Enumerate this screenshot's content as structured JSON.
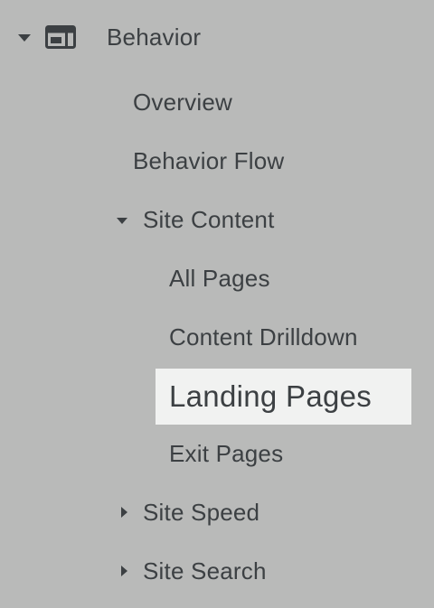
{
  "nav": {
    "section": {
      "label": "Behavior",
      "icon": "layout-icon",
      "expanded": true
    },
    "items": [
      {
        "label": "Overview"
      },
      {
        "label": "Behavior Flow"
      }
    ],
    "site_content": {
      "label": "Site Content",
      "expanded": true,
      "children": [
        {
          "label": "All Pages"
        },
        {
          "label": "Content Drilldown"
        },
        {
          "label": "Landing Pages",
          "selected": true
        },
        {
          "label": "Exit Pages"
        }
      ]
    },
    "site_speed": {
      "label": "Site Speed",
      "expanded": false
    },
    "site_search": {
      "label": "Site Search",
      "expanded": false
    }
  }
}
